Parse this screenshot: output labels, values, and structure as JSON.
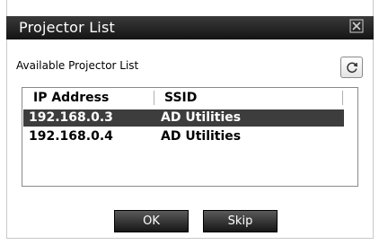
{
  "window": {
    "title": "Projector List",
    "close_glyph": "☒"
  },
  "main": {
    "label": "Available Projector List",
    "refresh_icon": "refresh-icon"
  },
  "table": {
    "columns": [
      "IP Address",
      "SSID"
    ],
    "rows": [
      {
        "ip": "192.168.0.3",
        "ssid": "AD Utilities",
        "selected": true
      },
      {
        "ip": "192.168.0.4",
        "ssid": "AD Utilities",
        "selected": false
      }
    ]
  },
  "buttons": {
    "ok": "OK",
    "skip": "Skip"
  },
  "colors": {
    "titlebar": "#1e1e1e",
    "selection": "#3d3d3d",
    "button": "#2b2b2b"
  }
}
